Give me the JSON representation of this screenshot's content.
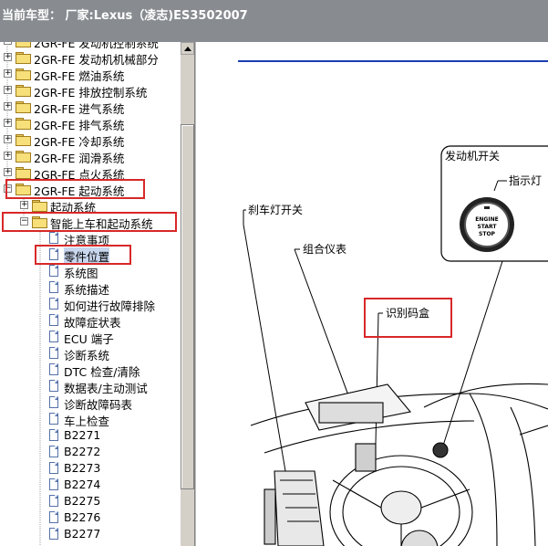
{
  "header": {
    "title": "当前车型： 厂家:Lexus（凌志)ES3502007"
  },
  "tree": {
    "items": [
      {
        "label": "2GR-FE 发动机控制系统",
        "type": "folder",
        "level": 0,
        "expander": "+"
      },
      {
        "label": "2GR-FE 发动机机械部分",
        "type": "folder",
        "level": 0,
        "expander": "+"
      },
      {
        "label": "2GR-FE 燃油系统",
        "type": "folder",
        "level": 0,
        "expander": "+"
      },
      {
        "label": "2GR-FE 排放控制系统",
        "type": "folder",
        "level": 0,
        "expander": "+"
      },
      {
        "label": "2GR-FE 进气系统",
        "type": "folder",
        "level": 0,
        "expander": "+"
      },
      {
        "label": "2GR-FE 排气系统",
        "type": "folder",
        "level": 0,
        "expander": "+"
      },
      {
        "label": "2GR-FE 冷却系统",
        "type": "folder",
        "level": 0,
        "expander": "+"
      },
      {
        "label": "2GR-FE 润滑系统",
        "type": "folder",
        "level": 0,
        "expander": "+"
      },
      {
        "label": "2GR-FE 点火系统",
        "type": "folder",
        "level": 0,
        "expander": "+"
      },
      {
        "label": "2GR-FE 起动系统",
        "type": "folder",
        "level": 0,
        "expander": "-",
        "highlight": true
      },
      {
        "label": "起动系统",
        "type": "folder",
        "level": 1,
        "expander": "+"
      },
      {
        "label": "智能上车和起动系统",
        "type": "folder",
        "level": 1,
        "expander": "-",
        "highlight": true
      },
      {
        "label": "注意事项",
        "type": "doc",
        "level": 2
      },
      {
        "label": "零件位置",
        "type": "doc",
        "level": 2,
        "selected": true,
        "highlight": true
      },
      {
        "label": "系统图",
        "type": "doc",
        "level": 2
      },
      {
        "label": "系统描述",
        "type": "doc",
        "level": 2
      },
      {
        "label": "如何进行故障排除",
        "type": "doc",
        "level": 2
      },
      {
        "label": "故障症状表",
        "type": "doc",
        "level": 2
      },
      {
        "label": "ECU 端子",
        "type": "doc",
        "level": 2
      },
      {
        "label": "诊断系统",
        "type": "doc",
        "level": 2
      },
      {
        "label": "DTC 检查/清除",
        "type": "doc",
        "level": 2
      },
      {
        "label": "数据表/主动测试",
        "type": "doc",
        "level": 2
      },
      {
        "label": "诊断故障码表",
        "type": "doc",
        "level": 2
      },
      {
        "label": "车上检查",
        "type": "doc",
        "level": 2
      },
      {
        "label": "B2271",
        "type": "doc",
        "level": 2
      },
      {
        "label": "B2272",
        "type": "doc",
        "level": 2
      },
      {
        "label": "B2273",
        "type": "doc",
        "level": 2
      },
      {
        "label": "B2274",
        "type": "doc",
        "level": 2
      },
      {
        "label": "B2275",
        "type": "doc",
        "level": 2
      },
      {
        "label": "B2276",
        "type": "doc",
        "level": 2
      },
      {
        "label": "B2277",
        "type": "doc",
        "level": 2
      }
    ]
  },
  "diagram": {
    "labels": {
      "engine_switch": "发动机开关",
      "indicator": "指示灯",
      "brake_switch": "刹车灯开关",
      "combo_meter": "组合仪表",
      "id_box": "识别码盒"
    },
    "button_text": [
      "ENGINE",
      "START",
      "STOP"
    ]
  },
  "colors": {
    "header_bg": "#888c91",
    "highlight": "#d82828",
    "selection": "#c8d6ee"
  }
}
